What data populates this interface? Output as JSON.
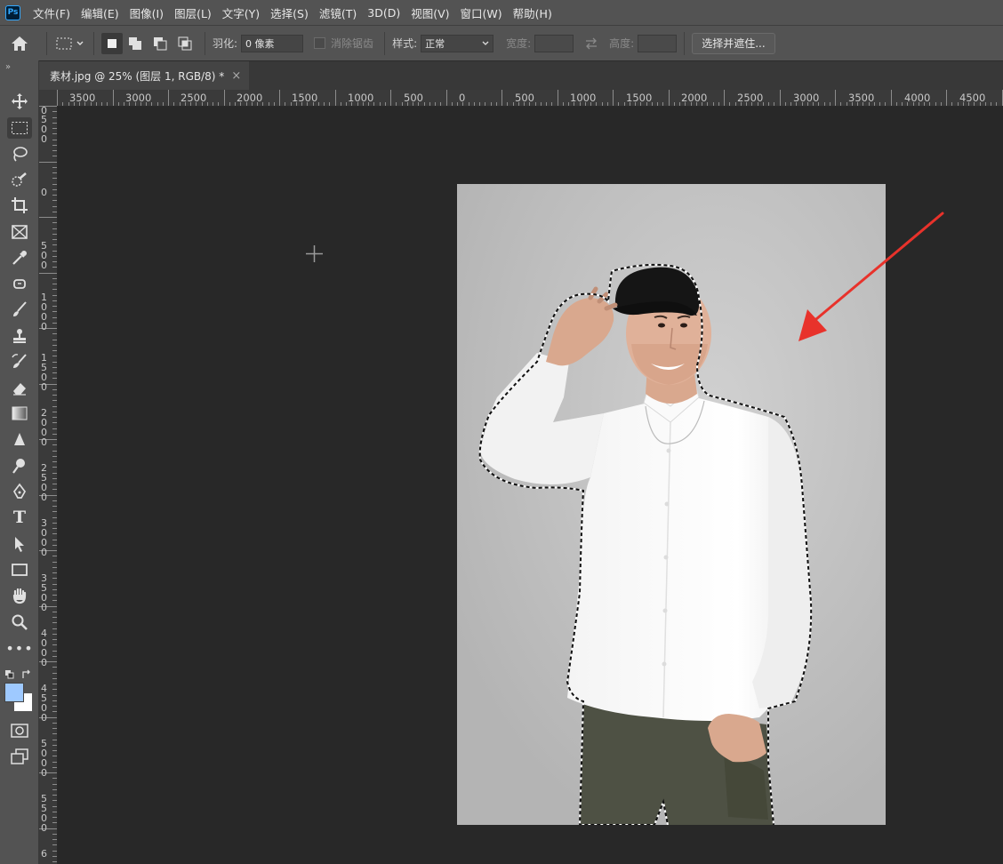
{
  "app": {
    "logo_text": "Ps"
  },
  "menu": [
    "文件(F)",
    "编辑(E)",
    "图像(I)",
    "图层(L)",
    "文字(Y)",
    "选择(S)",
    "滤镜(T)",
    "3D(D)",
    "视图(V)",
    "窗口(W)",
    "帮助(H)"
  ],
  "options": {
    "feather_label": "羽化:",
    "feather_value": "0 像素",
    "antialias_label": "消除锯齿",
    "style_label": "样式:",
    "style_value": "正常",
    "width_label": "宽度:",
    "height_label": "高度:",
    "select_mask_label": "选择并遮住..."
  },
  "document": {
    "tab_title": "素材.jpg @ 25% (图层 1, RGB/8) *",
    "close": "×"
  },
  "ruler": {
    "top_labels": [
      "3500",
      "3000",
      "2500",
      "2000",
      "1500",
      "1000",
      "500",
      "0",
      "500",
      "1000",
      "1500",
      "2000",
      "2500",
      "3000",
      "3500",
      "4000",
      "4500"
    ],
    "left_labels": [
      "0",
      "500",
      "0",
      "5 0 0",
      "1 0 0 0",
      "1 5 0 0",
      "2 0 0 0",
      "2 5 0 0",
      "3 0 0 0",
      "3 5 0 0",
      "4 0 0 0",
      "4 5 0 0",
      "5 0 0 0",
      "5 5 0 0",
      "6"
    ]
  },
  "colors": {
    "foreground": "#9ec9ff",
    "background": "#ffffff",
    "annotation_arrow": "#e8322b"
  },
  "icons": [
    "home-icon",
    "marquee-icon",
    "move-icon",
    "lasso-icon",
    "quick-select-icon",
    "crop-icon",
    "frame-icon",
    "eyedropper-icon",
    "healing-icon",
    "brush-icon",
    "stamp-icon",
    "history-brush-icon",
    "eraser-icon",
    "gradient-icon",
    "blur-icon",
    "dodge-icon",
    "pen-icon",
    "type-icon",
    "path-select-icon",
    "rectangle-icon",
    "hand-icon",
    "zoom-icon",
    "more-icon",
    "quick-mask-icon",
    "screen-mode-icon"
  ]
}
